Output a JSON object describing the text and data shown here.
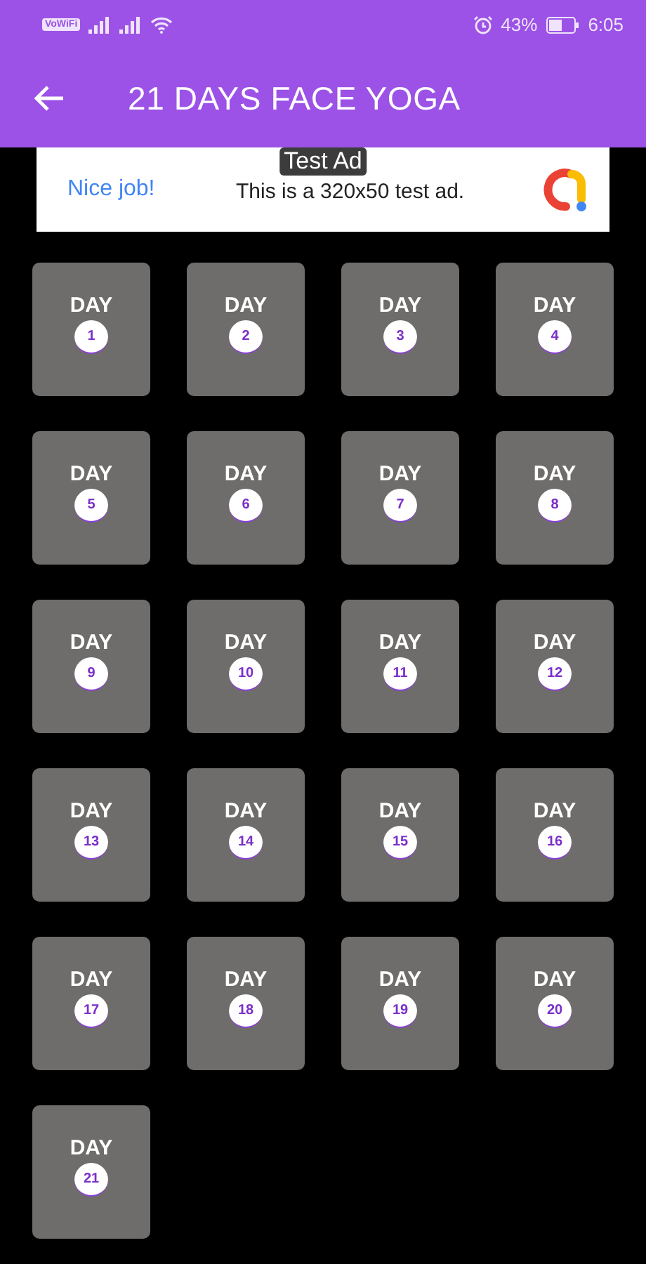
{
  "status_bar": {
    "badge": "VoWiFi",
    "battery": "43%",
    "time": "6:05"
  },
  "app_bar": {
    "title": "21 DAYS FACE YOGA"
  },
  "ad": {
    "label": "Test Ad",
    "headline": "Nice job!",
    "text": "This is a 320x50 test ad."
  },
  "days": [
    {
      "label": "DAY",
      "number": "1"
    },
    {
      "label": "DAY",
      "number": "2"
    },
    {
      "label": "DAY",
      "number": "3"
    },
    {
      "label": "DAY",
      "number": "4"
    },
    {
      "label": "DAY",
      "number": "5"
    },
    {
      "label": "DAY",
      "number": "6"
    },
    {
      "label": "DAY",
      "number": "7"
    },
    {
      "label": "DAY",
      "number": "8"
    },
    {
      "label": "DAY",
      "number": "9"
    },
    {
      "label": "DAY",
      "number": "10"
    },
    {
      "label": "DAY",
      "number": "11"
    },
    {
      "label": "DAY",
      "number": "12"
    },
    {
      "label": "DAY",
      "number": "13"
    },
    {
      "label": "DAY",
      "number": "14"
    },
    {
      "label": "DAY",
      "number": "15"
    },
    {
      "label": "DAY",
      "number": "16"
    },
    {
      "label": "DAY",
      "number": "17"
    },
    {
      "label": "DAY",
      "number": "18"
    },
    {
      "label": "DAY",
      "number": "19"
    },
    {
      "label": "DAY",
      "number": "20"
    },
    {
      "label": "DAY",
      "number": "21"
    }
  ]
}
